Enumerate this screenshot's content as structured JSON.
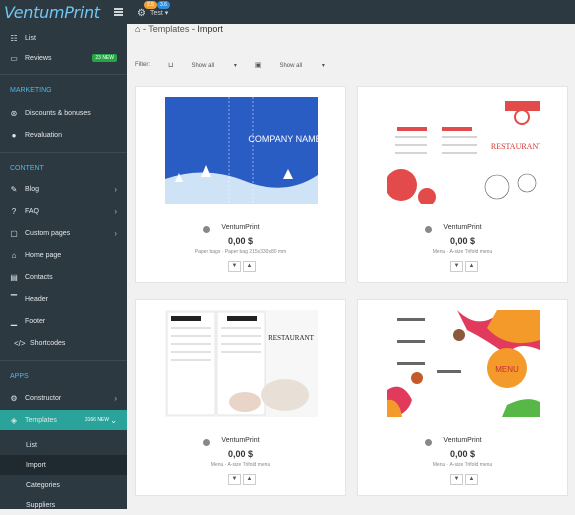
{
  "app": {
    "logo": "VentumPrint",
    "user_label": "Test",
    "badge1": "2.5",
    "badge2": "3.6"
  },
  "sidebar": {
    "items": [
      {
        "label": "List",
        "icon": "list-icon"
      },
      {
        "label": "Reviews",
        "icon": "reviews-icon",
        "badge": "23 NEW"
      },
      {
        "label": "Discounts & bonuses",
        "icon": "discount-icon"
      },
      {
        "label": "Revaluation",
        "icon": "revaluation-icon"
      },
      {
        "label": "Blog",
        "icon": "blog-icon"
      },
      {
        "label": "FAQ",
        "icon": "faq-icon"
      },
      {
        "label": "Custom pages",
        "icon": "pages-icon"
      },
      {
        "label": "Home page",
        "icon": "home-icon"
      },
      {
        "label": "Contacts",
        "icon": "contacts-icon"
      },
      {
        "label": "Header",
        "icon": "header-icon"
      },
      {
        "label": "Footer",
        "icon": "footer-icon"
      },
      {
        "label": "Shortcodes",
        "icon": "shortcodes-icon"
      },
      {
        "label": "Constructor",
        "icon": "constructor-icon"
      },
      {
        "label": "Templates",
        "icon": "templates-icon",
        "badge": "3166 NEW"
      }
    ],
    "sections": {
      "marketing": "MARKETING",
      "content": "CONTENT",
      "apps": "APPS"
    },
    "subitems": [
      "List",
      "Import",
      "Categories",
      "Suppliers"
    ]
  },
  "breadcrumb": {
    "sep1": "-",
    "templates": "Templates",
    "sep2": "-",
    "import": "Import"
  },
  "filter": {
    "label": "Filter:",
    "opt1": "Show all",
    "opt2": "Show all"
  },
  "cards": [
    {
      "supplier": "VentumPrint",
      "price": "0,00 $",
      "meta1": "Paper bags",
      "meta2": "Paper bag 215x330x80 mm",
      "img_text": "COMPANY NAME"
    },
    {
      "supplier": "VentumPrint",
      "price": "0,00 $",
      "meta1": "Menu",
      "meta2": "A-size Trifold menu",
      "img_text": "RESTAURANT"
    },
    {
      "supplier": "VentumPrint",
      "price": "0,00 $",
      "meta1": "Menu",
      "meta2": "A-size Trifold menu",
      "img_text": "RESTAURANT"
    },
    {
      "supplier": "VentumPrint",
      "price": "0,00 $",
      "meta1": "Menu",
      "meta2": "A-size Trifold menu",
      "img_text": "MENU"
    }
  ]
}
